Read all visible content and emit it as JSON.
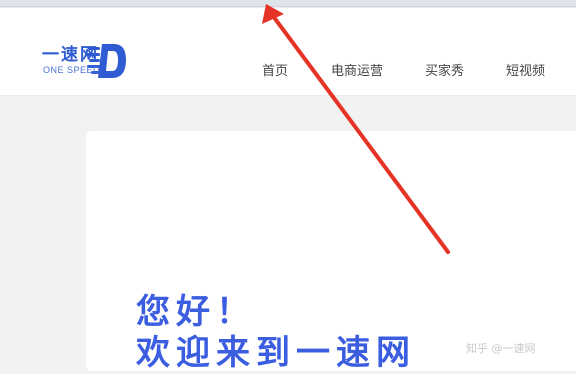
{
  "brand": {
    "name_cn": "一速网",
    "name_en": "ONE SPEED",
    "color": "#2f5bd3"
  },
  "nav": {
    "items": [
      {
        "label": "首页"
      },
      {
        "label": "电商运营"
      },
      {
        "label": "买家秀"
      },
      {
        "label": "短视频"
      }
    ]
  },
  "hero": {
    "line1": "您好！",
    "line2": "欢迎来到一速网",
    "color": "#3b5de0"
  },
  "annotation": {
    "arrow_color": "#e53325"
  },
  "watermark": {
    "text": "知乎 @一速网"
  }
}
